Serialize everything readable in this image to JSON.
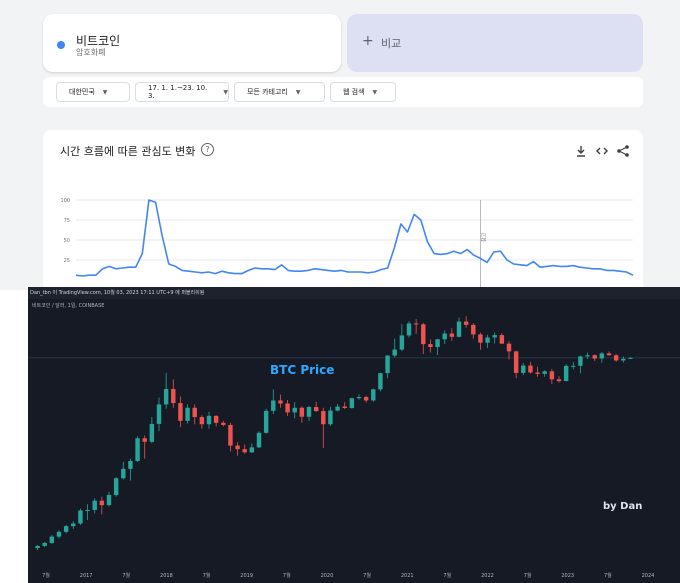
{
  "trends": {
    "term": {
      "name": "비트코인",
      "category": "암호화폐",
      "color": "#4285f4"
    },
    "compare": {
      "plus": "+",
      "label": "비교"
    },
    "filters": [
      {
        "label": "대한민국"
      },
      {
        "label": "17. 1. 1.~23. 10. 3."
      },
      {
        "label": "모든 카테고리"
      },
      {
        "label": "웹 검색"
      }
    ],
    "chart_title": "시간 흐름에 따른 관심도 변화",
    "help_glyph": "?",
    "icons": [
      "download-icon",
      "embed-icon",
      "share-icon"
    ],
    "note_marker": "참고"
  },
  "tradingview": {
    "header_text": "Dan_tbn 이 TradingView.com, 10월 03, 2023 17:11 UTC+9 에 퍼블리쉬됨",
    "symbol_text": "비트코인 / 달러, 1일, COINBASE",
    "overlay_title": "BTC Price",
    "author_label": "by Dan",
    "up_color": "#26a69a",
    "down_color": "#ef5350"
  },
  "chart_data": [
    {
      "type": "line",
      "title": "시간 흐름에 따른 관심도 변화",
      "ylim": [
        0,
        100
      ],
      "y_ticks": [
        "100",
        "75",
        "50",
        "25"
      ],
      "grid": true,
      "series": [
        {
          "name": "비트코인",
          "values": [
            6,
            5,
            6,
            6,
            14,
            17,
            14,
            15,
            16,
            16,
            33,
            100,
            97,
            55,
            20,
            17,
            12,
            11,
            10,
            9,
            10,
            8,
            11,
            9,
            8,
            8,
            12,
            15,
            14,
            14,
            13,
            19,
            12,
            11,
            11,
            12,
            14,
            13,
            12,
            11,
            12,
            10,
            10,
            10,
            9,
            10,
            13,
            15,
            40,
            70,
            60,
            82,
            75,
            48,
            33,
            32,
            33,
            36,
            33,
            38,
            31,
            27,
            22,
            35,
            36,
            25,
            20,
            19,
            18,
            23,
            16,
            17,
            18,
            17,
            17,
            18,
            16,
            15,
            14,
            14,
            12,
            12,
            11,
            10,
            6
          ]
        }
      ]
    },
    {
      "type": "bar",
      "title": "BTC Price",
      "x_ticks": [
        "7월",
        "2017",
        "7월",
        "2018",
        "7월",
        "2019",
        "7월",
        "2020",
        "7월",
        "2021",
        "7월",
        "2022",
        "7월",
        "2023",
        "7월",
        "2024"
      ],
      "candles": [
        [
          420,
          450,
          400,
          440
        ],
        [
          440,
          480,
          430,
          470
        ],
        [
          470,
          560,
          460,
          540
        ],
        [
          540,
          620,
          520,
          600
        ],
        [
          600,
          700,
          580,
          680
        ],
        [
          680,
          760,
          640,
          720
        ],
        [
          720,
          1000,
          700,
          960
        ],
        [
          960,
          1100,
          780,
          970
        ],
        [
          970,
          1250,
          900,
          1190
        ],
        [
          1190,
          1300,
          880,
          1080
        ],
        [
          1080,
          1450,
          1050,
          1350
        ],
        [
          1350,
          2000,
          1300,
          1950
        ],
        [
          1950,
          2800,
          1900,
          2400
        ],
        [
          2400,
          3000,
          1850,
          2850
        ],
        [
          2850,
          4900,
          2800,
          4700
        ],
        [
          4700,
          5000,
          3000,
          4350
        ],
        [
          4350,
          7500,
          4200,
          6450
        ],
        [
          6450,
          11500,
          5500,
          9900
        ],
        [
          9900,
          19800,
          9000,
          13900
        ],
        [
          13900,
          17200,
          9200,
          10200
        ],
        [
          10200,
          11800,
          6000,
          6900
        ],
        [
          6900,
          9900,
          6500,
          9200
        ],
        [
          9200,
          9900,
          6400,
          7500
        ],
        [
          7500,
          7800,
          5800,
          6400
        ],
        [
          6400,
          8400,
          5800,
          7700
        ],
        [
          7700,
          7800,
          6100,
          6600
        ],
        [
          6600,
          6900,
          6100,
          6300
        ],
        [
          6300,
          6600,
          3500,
          4000
        ],
        [
          4000,
          4300,
          3200,
          3700
        ],
        [
          3700,
          4100,
          3350,
          3450
        ],
        [
          3450,
          4200,
          3400,
          3850
        ],
        [
          3850,
          5500,
          3800,
          5300
        ],
        [
          5300,
          9000,
          5200,
          8600
        ],
        [
          8600,
          13800,
          8000,
          10800
        ],
        [
          10800,
          12300,
          9200,
          10100
        ],
        [
          10100,
          10900,
          7700,
          8300
        ],
        [
          8300,
          10400,
          7300,
          9200
        ],
        [
          9200,
          9500,
          6600,
          7550
        ],
        [
          7550,
          9600,
          6900,
          9350
        ],
        [
          9350,
          10500,
          8400,
          8550
        ],
        [
          8550,
          9200,
          3800,
          6400
        ],
        [
          6400,
          9400,
          6150,
          8650
        ],
        [
          8650,
          10000,
          8500,
          9450
        ],
        [
          9450,
          10400,
          8950,
          9150
        ],
        [
          9150,
          11500,
          9000,
          11350
        ],
        [
          11350,
          12400,
          11000,
          11650
        ],
        [
          11650,
          12000,
          10300,
          10800
        ],
        [
          10800,
          14000,
          10500,
          13800
        ],
        [
          13800,
          19800,
          13200,
          19700
        ],
        [
          19700,
          29300,
          17600,
          29000
        ],
        [
          29000,
          42000,
          28000,
          33100
        ],
        [
          33100,
          58000,
          32000,
          45200
        ],
        [
          45200,
          61800,
          43000,
          58800
        ],
        [
          58800,
          64800,
          47000,
          57700
        ],
        [
          57700,
          59500,
          30000,
          37300
        ],
        [
          37300,
          41300,
          31000,
          35000
        ],
        [
          35000,
          42000,
          29300,
          41500
        ],
        [
          41500,
          50500,
          37500,
          47100
        ],
        [
          47100,
          52900,
          40000,
          43800
        ],
        [
          43800,
          66900,
          43300,
          61300
        ],
        [
          61300,
          69000,
          53500,
          57000
        ],
        [
          57000,
          59000,
          42000,
          46200
        ],
        [
          46200,
          48000,
          33000,
          38500
        ],
        [
          38500,
          45800,
          34300,
          43200
        ],
        [
          43200,
          48200,
          37800,
          45500
        ],
        [
          45500,
          47400,
          37500,
          37700
        ],
        [
          37700,
          39900,
          26700,
          31800
        ],
        [
          31800,
          32300,
          17600,
          19800
        ],
        [
          19800,
          24600,
          18900,
          23300
        ],
        [
          23300,
          25200,
          19500,
          20000
        ],
        [
          20000,
          22700,
          18200,
          19400
        ],
        [
          19400,
          21000,
          18200,
          20500
        ],
        [
          20500,
          21500,
          15500,
          17200
        ],
        [
          17200,
          18400,
          16000,
          16550
        ],
        [
          16550,
          23900,
          16500,
          23100
        ],
        [
          23100,
          25200,
          21400,
          23150
        ],
        [
          23150,
          28900,
          19600,
          28500
        ],
        [
          28500,
          31000,
          27000,
          29250
        ],
        [
          29250,
          29800,
          25800,
          27200
        ],
        [
          27200,
          31400,
          24800,
          30450
        ],
        [
          30450,
          31800,
          28900,
          29200
        ],
        [
          29200,
          30000,
          25300,
          26050
        ],
        [
          26050,
          28500,
          24900,
          27000
        ],
        [
          27000,
          28000,
          26800,
          27600
        ]
      ]
    }
  ]
}
